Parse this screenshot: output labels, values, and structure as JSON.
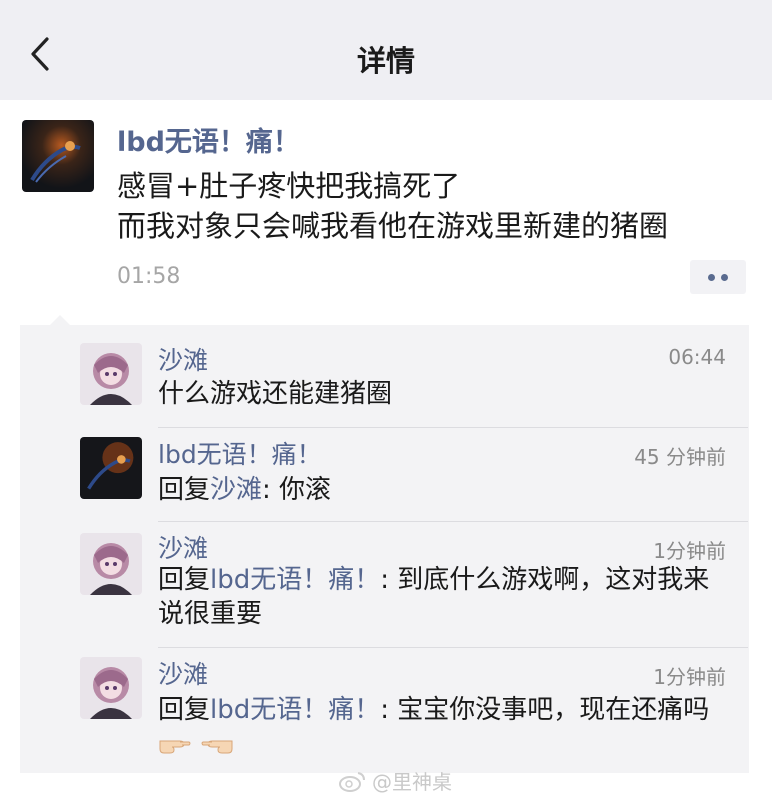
{
  "navbar": {
    "title": "详情"
  },
  "post": {
    "author": "lbd无语！痛！",
    "lines": [
      "感冒+肚子疼快把我搞死了",
      "而我对象只会喊我看他在游戏里新建的猪圈"
    ],
    "time": "01:58"
  },
  "comments": [
    {
      "name": "沙滩",
      "time": "06:44",
      "text": "什么游戏还能建猪圈",
      "avatar": "anime-girl"
    },
    {
      "name": "lbd无语！痛！",
      "time": "45 分钟前",
      "reply_prefix": "回复",
      "reply_to": "沙滩",
      "reply_body": ": 你滚",
      "avatar": "dark-hand"
    },
    {
      "name": "沙滩",
      "time": "1分钟前",
      "reply_prefix": "回复",
      "reply_to": "lbd无语！痛！",
      "reply_body": ": 到底什么游戏啊，这对我来说很重要",
      "avatar": "anime-girl"
    },
    {
      "name": "沙滩",
      "time": "1分钟前",
      "reply_prefix": "回复",
      "reply_to": "lbd无语！痛！",
      "reply_body": ": 宝宝你没事吧，现在还痛吗",
      "emoji": "👉👈",
      "avatar": "anime-girl"
    }
  ],
  "watermark": "@里神桌",
  "colors": {
    "link": "#55668f",
    "navbar_bg": "#efeff3",
    "comments_bg": "#f3f3f5"
  }
}
